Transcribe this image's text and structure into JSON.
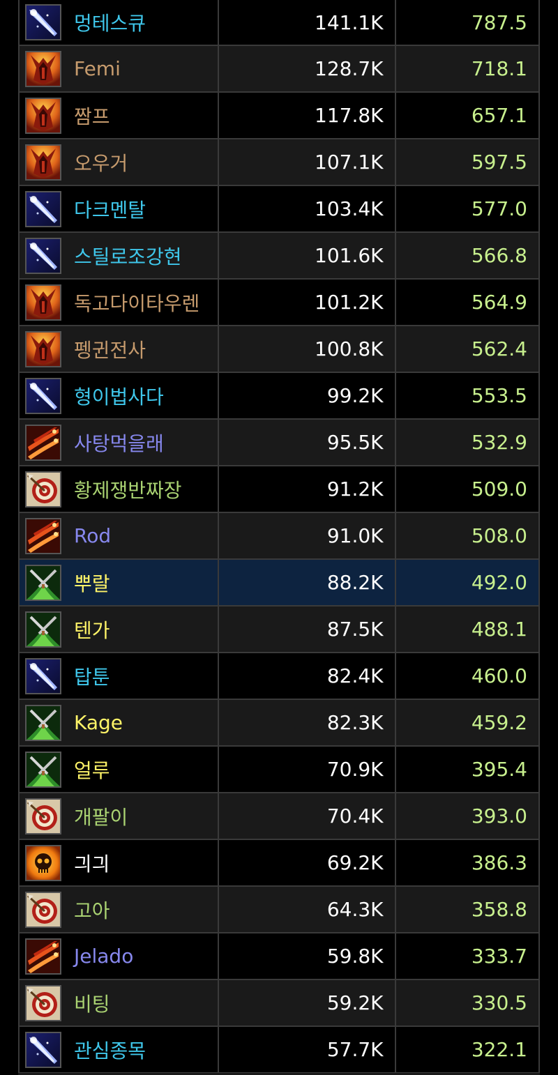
{
  "class_colors": {
    "mage": "#3fc7eb",
    "warrior": "#c69b6d",
    "warlock": "#8788ee",
    "rogue": "#fff468",
    "hunter": "#aad372",
    "priest": "#ffffff"
  },
  "value_colors": {
    "damage": "#ffffff",
    "dps": "#c8f08e"
  },
  "rows": [
    {
      "name": "멍테스큐",
      "damage": "141.1K",
      "dps": "787.5",
      "class": "mage",
      "icon": "frost-spike-icon"
    },
    {
      "name": "Femi",
      "damage": "128.7K",
      "dps": "718.1",
      "class": "warrior",
      "icon": "warrior-helm-icon"
    },
    {
      "name": "짬프",
      "damage": "117.8K",
      "dps": "657.1",
      "class": "warrior",
      "icon": "warrior-helm-icon"
    },
    {
      "name": "오우거",
      "damage": "107.1K",
      "dps": "597.5",
      "class": "warrior",
      "icon": "warrior-helm-icon"
    },
    {
      "name": "다크멘탈",
      "damage": "103.4K",
      "dps": "577.0",
      "class": "mage",
      "icon": "frost-spike-icon"
    },
    {
      "name": "스틸로조강현",
      "damage": "101.6K",
      "dps": "566.8",
      "class": "mage",
      "icon": "frost-spike-icon"
    },
    {
      "name": "독고다이타우렌",
      "damage": "101.2K",
      "dps": "564.9",
      "class": "warrior",
      "icon": "warrior-helm-icon"
    },
    {
      "name": "펭귄전사",
      "damage": "100.8K",
      "dps": "562.4",
      "class": "warrior",
      "icon": "warrior-helm-icon"
    },
    {
      "name": "형이법사다",
      "damage": "99.2K",
      "dps": "553.5",
      "class": "mage",
      "icon": "frost-spike-icon"
    },
    {
      "name": "사탕먹을래",
      "damage": "95.5K",
      "dps": "532.9",
      "class": "warlock",
      "icon": "fire-streak-icon"
    },
    {
      "name": "황제쟁반짜장",
      "damage": "91.2K",
      "dps": "509.0",
      "class": "hunter",
      "icon": "target-bullseye-icon"
    },
    {
      "name": "Rod",
      "damage": "91.0K",
      "dps": "508.0",
      "class": "warlock",
      "icon": "fire-streak-icon"
    },
    {
      "name": "뿌랄",
      "damage": "88.2K",
      "dps": "492.0",
      "class": "rogue",
      "icon": "crossed-daggers-icon",
      "highlight": true
    },
    {
      "name": "텐가",
      "damage": "87.5K",
      "dps": "488.1",
      "class": "rogue",
      "icon": "crossed-daggers-icon"
    },
    {
      "name": "탑툰",
      "damage": "82.4K",
      "dps": "460.0",
      "class": "mage",
      "icon": "frost-spike-icon"
    },
    {
      "name": "Kage",
      "damage": "82.3K",
      "dps": "459.2",
      "class": "rogue",
      "icon": "crossed-daggers-icon"
    },
    {
      "name": "얼루",
      "damage": "70.9K",
      "dps": "395.4",
      "class": "rogue",
      "icon": "crossed-daggers-icon"
    },
    {
      "name": "개팔이",
      "damage": "70.4K",
      "dps": "393.0",
      "class": "hunter",
      "icon": "target-bullseye-icon"
    },
    {
      "name": "긔긔",
      "damage": "69.2K",
      "dps": "386.3",
      "class": "priest",
      "icon": "flaming-skull-icon"
    },
    {
      "name": "고아",
      "damage": "64.3K",
      "dps": "358.8",
      "class": "hunter",
      "icon": "target-bullseye-icon"
    },
    {
      "name": "Jelado",
      "damage": "59.8K",
      "dps": "333.7",
      "class": "warlock",
      "icon": "fire-streak-icon"
    },
    {
      "name": "비팅",
      "damage": "59.2K",
      "dps": "330.5",
      "class": "hunter",
      "icon": "target-bullseye-icon"
    },
    {
      "name": "관심종목",
      "damage": "57.7K",
      "dps": "322.1",
      "class": "mage",
      "icon": "frost-spike-icon"
    }
  ]
}
